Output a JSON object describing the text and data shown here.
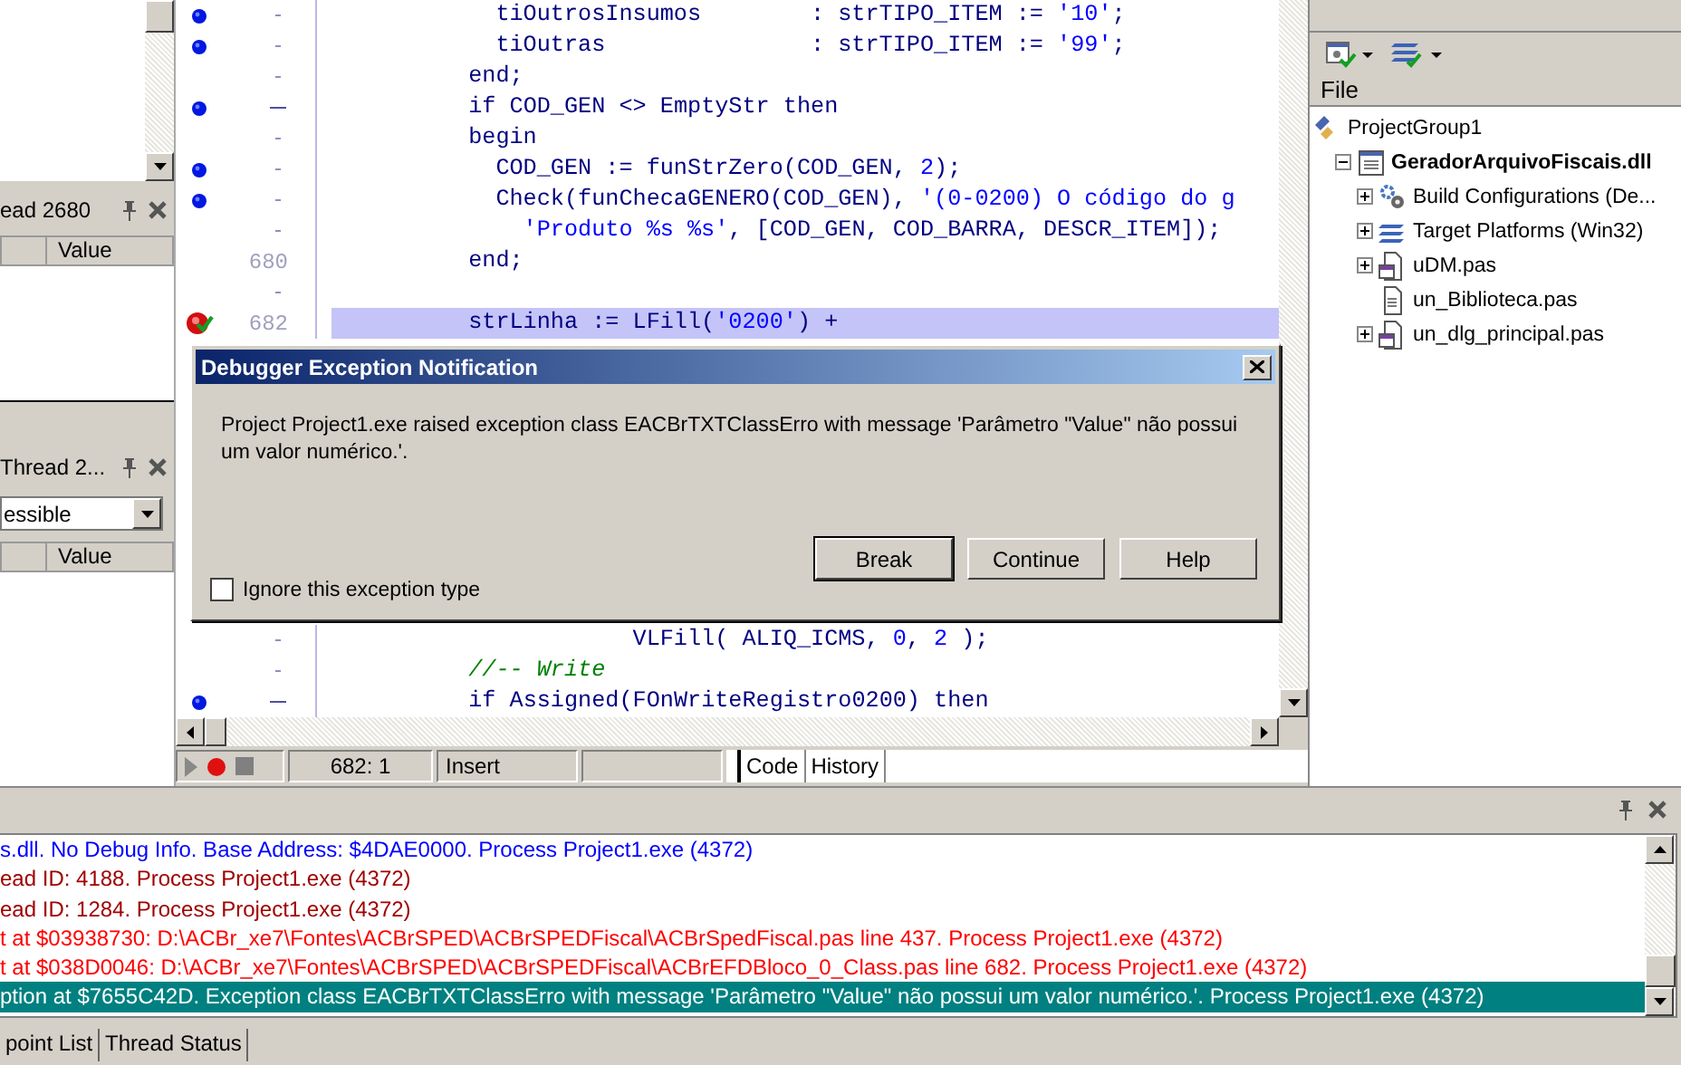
{
  "left_pane": {
    "panel_1": {
      "title": "ead 2680",
      "column_header": "Value"
    },
    "panel_2": {
      "title": "Thread 2...",
      "combo_value": "essible",
      "column_header": "Value"
    }
  },
  "editor": {
    "lines_top": [
      {
        "kind": "breakpoint",
        "fold": false,
        "highlighted": false,
        "tokens": [
          {
            "kind": "text",
            "t": "            tiOutrosInsumos        : strTIPO_ITEM := "
          },
          {
            "kind": "string",
            "t": "'10'"
          },
          {
            "kind": "text",
            "t": ";"
          }
        ]
      },
      {
        "kind": "breakpoint",
        "fold": false,
        "highlighted": false,
        "tokens": [
          {
            "kind": "text",
            "t": "            tiOutras               : strTIPO_ITEM := "
          },
          {
            "kind": "string",
            "t": "'99'"
          },
          {
            "kind": "text",
            "t": ";"
          }
        ]
      },
      {
        "kind": "plain",
        "fold": false,
        "highlighted": false,
        "tokens": [
          {
            "kind": "keyword",
            "t": "          end"
          },
          {
            "kind": "text",
            "t": ";"
          }
        ]
      },
      {
        "kind": "breakpoint",
        "fold": true,
        "highlighted": false,
        "tokens": [
          {
            "kind": "keyword",
            "t": "          if"
          },
          {
            "kind": "text",
            "t": " COD_GEN <> EmptyStr "
          },
          {
            "kind": "keyword",
            "t": "then"
          }
        ]
      },
      {
        "kind": "plain",
        "fold": false,
        "highlighted": false,
        "tokens": [
          {
            "kind": "keyword",
            "t": "          begin"
          }
        ]
      },
      {
        "kind": "breakpoint",
        "fold": false,
        "highlighted": false,
        "tokens": [
          {
            "kind": "text",
            "t": "            COD_GEN := funStrZero(COD_GEN, "
          },
          {
            "kind": "number",
            "t": "2"
          },
          {
            "kind": "text",
            "t": ");"
          }
        ]
      },
      {
        "kind": "breakpoint",
        "fold": false,
        "highlighted": false,
        "tokens": [
          {
            "kind": "text",
            "t": "            Check(funChecaGENERO(COD_GEN), "
          },
          {
            "kind": "string",
            "t": "'(0-0200) O código do g"
          }
        ]
      },
      {
        "kind": "plain",
        "fold": false,
        "highlighted": false,
        "tokens": [
          {
            "kind": "string",
            "t": "              'Produto %s %s'"
          },
          {
            "kind": "text",
            "t": ", [COD_GEN, COD_BARRA, DESCR_ITEM]);"
          }
        ]
      },
      {
        "kind": "plain",
        "highlighted": false,
        "number": "680",
        "tokens": [
          {
            "kind": "keyword",
            "t": "          end"
          },
          {
            "kind": "text",
            "t": ";"
          }
        ]
      },
      {
        "kind": "plain",
        "fold": false,
        "highlighted": false
      },
      {
        "kind": "execution",
        "highlighted": true,
        "number": "682",
        "tokens": [
          {
            "kind": "text",
            "t": "          strLinha := LFill("
          },
          {
            "kind": "string",
            "t": "'0200'"
          },
          {
            "kind": "text",
            "t": ") +"
          }
        ]
      }
    ],
    "lines_bottom": [
      {
        "kind": "plain",
        "fold": false,
        "highlighted": false,
        "tokens": [
          {
            "kind": "text",
            "t": "                      VLFill( ALIQ_ICMS, "
          },
          {
            "kind": "number",
            "t": "0"
          },
          {
            "kind": "text",
            "t": ", "
          },
          {
            "kind": "number",
            "t": "2"
          },
          {
            "kind": "text",
            "t": " );"
          }
        ]
      },
      {
        "kind": "plain",
        "fold": false,
        "highlighted": false,
        "tokens": [
          {
            "kind": "comment",
            "t": "          //-- Write"
          }
        ]
      },
      {
        "kind": "breakpoint",
        "fold": true,
        "highlighted": false,
        "tokens": [
          {
            "kind": "keyword",
            "t": "          if"
          },
          {
            "kind": "text",
            "t": " Assigned(FOnWriteRegistro0200) "
          },
          {
            "kind": "keyword",
            "t": "then"
          }
        ]
      }
    ],
    "status": {
      "position": "682:  1",
      "mode": "Insert"
    },
    "tabs": [
      {
        "label": "Code",
        "selected": true
      },
      {
        "label": "History",
        "selected": false
      }
    ]
  },
  "dialog": {
    "title": "Debugger Exception Notification",
    "message": "Project Project1.exe raised exception class EACBrTXTClassErro with message 'Parâmetro \"Value\" não possui um valor numérico.'.",
    "checkbox": {
      "label": "Ignore this exception type",
      "checked": false
    },
    "buttons": [
      {
        "label": "Break",
        "default": true
      },
      {
        "label": "Continue",
        "default": false
      },
      {
        "label": "Help",
        "default": false
      }
    ]
  },
  "project_manager": {
    "column_header": "File",
    "tree": [
      {
        "label": "ProjectGroup1",
        "kind": "group",
        "bold": false,
        "children": [
          {
            "label": "GeradorArquivoFiscais.dll",
            "kind": "project",
            "bold": true,
            "expanded": true,
            "children": [
              {
                "label": "Build Configurations (De...",
                "kind": "gears",
                "bold": false,
                "expanded": false
              },
              {
                "label": "Target Platforms (Win32)",
                "kind": "layers",
                "bold": false,
                "expanded": false
              },
              {
                "label": "uDM.pas",
                "kind": "form_unit",
                "bold": false,
                "expanded": false
              },
              {
                "label": "un_Biblioteca.pas",
                "kind": "unit",
                "bold": false
              },
              {
                "label": "un_dlg_principal.pas",
                "kind": "form_unit",
                "bold": false,
                "expanded": false
              }
            ]
          }
        ]
      }
    ]
  },
  "messages": {
    "lines": [
      {
        "text": "s.dll. No Debug Info. Base Address: $4DAE0000. Process Project1.exe (4372)",
        "color": "#0000ff",
        "selected": false
      },
      {
        "text": "ead ID: 4188. Process Project1.exe (4372)",
        "color": "#a00000",
        "selected": false
      },
      {
        "text": "ead ID: 1284. Process Project1.exe (4372)",
        "color": "#a00000",
        "selected": false
      },
      {
        "text": "t at $03938730: D:\\ACBr_xe7\\Fontes\\ACBrSPED\\ACBrSPEDFiscal\\ACBrSpedFiscal.pas line 437. Process Project1.exe (4372)",
        "color": "#ff0000",
        "selected": false
      },
      {
        "text": "t at $038D0046: D:\\ACBr_xe7\\Fontes\\ACBrSPED\\ACBrSPEDFiscal\\ACBrEFDBloco_0_Class.pas line 682. Process Project1.exe (4372)",
        "color": "#ff0000",
        "selected": false
      },
      {
        "text": "ption at $7655C42D. Exception class EACBrTXTClassErro with message 'Parâmetro \"Value\" não possui um valor numérico.'. Process Project1.exe (4372)",
        "selected": true
      }
    ]
  },
  "bottom_tabs": [
    {
      "label": "point List",
      "selected": false
    },
    {
      "label": "Thread Status",
      "selected": false
    }
  ]
}
